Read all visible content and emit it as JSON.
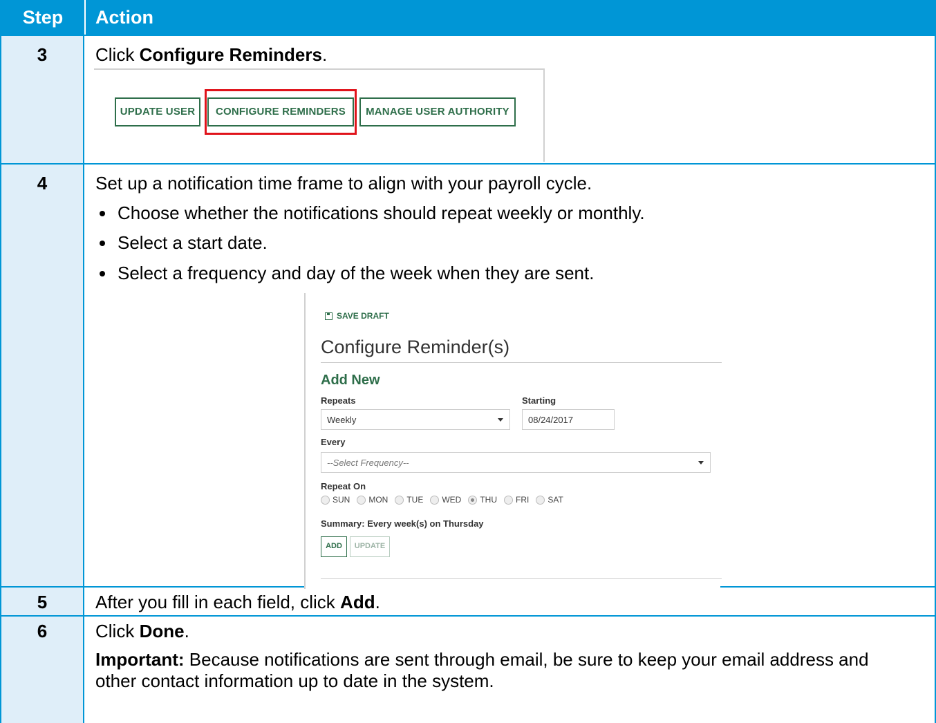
{
  "header": {
    "step": "Step",
    "action": "Action"
  },
  "rows": [
    {
      "step": "3",
      "text_pre": "Click ",
      "text_bold": "Configure Reminders",
      "text_post": "."
    },
    {
      "step": "4",
      "text": "Set up a notification time frame to align with your payroll cycle.",
      "bullets": [
        "Choose whether the notifications should repeat weekly or monthly.",
        "Select a start date.",
        "Select a frequency and day of the week when they are sent."
      ]
    },
    {
      "step": "5",
      "text_pre": "After you fill in each field, click ",
      "text_bold": "Add",
      "text_post": "."
    },
    {
      "step": "6",
      "text_pre": "Click ",
      "text_bold": "Done",
      "text_post": ".",
      "important_label": "Important:",
      "important_text": " Because notifications are sent through email, be sure to keep your email address and other contact information up to date in the system."
    }
  ],
  "shot1": {
    "buttons": [
      "UPDATE USER",
      "CONFIGURE REMINDERS",
      "MANAGE USER AUTHORITY"
    ],
    "highlight_color": "#e0131b",
    "accent": "#2e6e4a"
  },
  "shot2": {
    "save_draft": "SAVE DRAFT",
    "save_icon": "save-disk-icon",
    "title": "Configure Reminder(s)",
    "add_new": "Add New",
    "repeats_label": "Repeats",
    "repeats_value": "Weekly",
    "starting_label": "Starting",
    "starting_value": "08/24/2017",
    "every_label": "Every",
    "every_placeholder": "--Select Frequency--",
    "repeat_on_label": "Repeat On",
    "days": [
      "SUN",
      "MON",
      "TUE",
      "WED",
      "THU",
      "FRI",
      "SAT"
    ],
    "selected_day": "THU",
    "summary": "Summary: Every  week(s) on Thursday",
    "add_button": "ADD",
    "update_button": "UPDATE"
  },
  "colors": {
    "header_blue": "#0096d6",
    "step_cell": "#dfeef9"
  }
}
